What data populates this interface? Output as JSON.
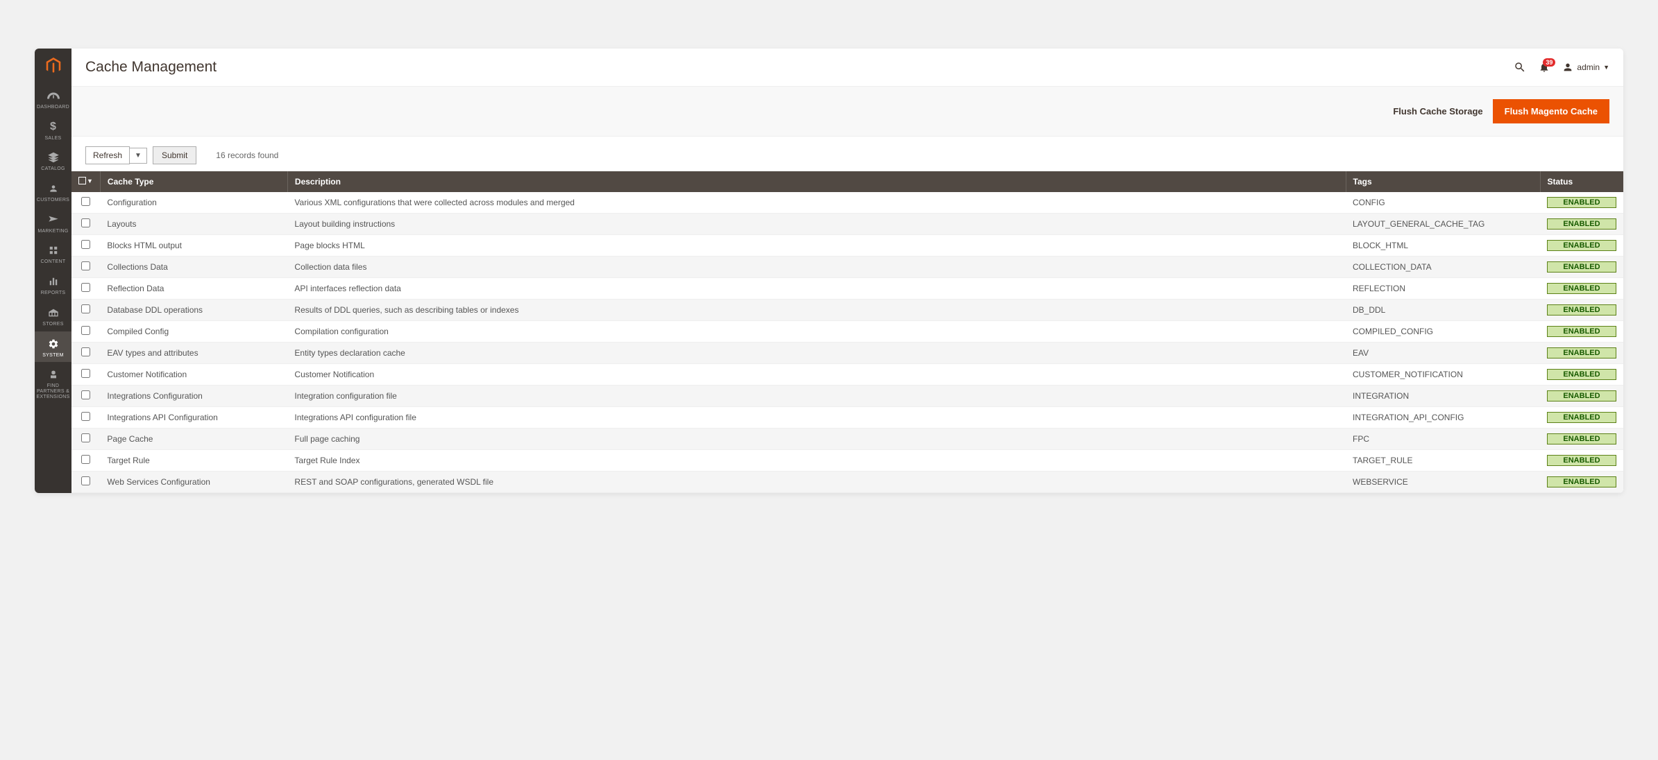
{
  "page": {
    "title": "Cache Management"
  },
  "header": {
    "notification_count": "39",
    "user_label": "admin"
  },
  "actions": {
    "flush_storage": "Flush Cache Storage",
    "flush_magento": "Flush Magento Cache"
  },
  "toolbar": {
    "refresh": "Refresh",
    "submit": "Submit",
    "records": "16 records found"
  },
  "columns": {
    "cache_type": "Cache Type",
    "description": "Description",
    "tags": "Tags",
    "status": "Status"
  },
  "status_label": "ENABLED",
  "sidebar": [
    {
      "label": "DASHBOARD"
    },
    {
      "label": "SALES"
    },
    {
      "label": "CATALOG"
    },
    {
      "label": "CUSTOMERS"
    },
    {
      "label": "MARKETING"
    },
    {
      "label": "CONTENT"
    },
    {
      "label": "REPORTS"
    },
    {
      "label": "STORES"
    },
    {
      "label": "SYSTEM"
    },
    {
      "label": "FIND PARTNERS & EXTENSIONS"
    }
  ],
  "rows": [
    {
      "type": "Configuration",
      "desc": "Various XML configurations that were collected across modules and merged",
      "tags": "CONFIG"
    },
    {
      "type": "Layouts",
      "desc": "Layout building instructions",
      "tags": "LAYOUT_GENERAL_CACHE_TAG"
    },
    {
      "type": "Blocks HTML output",
      "desc": "Page blocks HTML",
      "tags": "BLOCK_HTML"
    },
    {
      "type": "Collections Data",
      "desc": "Collection data files",
      "tags": "COLLECTION_DATA"
    },
    {
      "type": "Reflection Data",
      "desc": "API interfaces reflection data",
      "tags": "REFLECTION"
    },
    {
      "type": "Database DDL operations",
      "desc": "Results of DDL queries, such as describing tables or indexes",
      "tags": "DB_DDL"
    },
    {
      "type": "Compiled Config",
      "desc": "Compilation configuration",
      "tags": "COMPILED_CONFIG"
    },
    {
      "type": "EAV types and attributes",
      "desc": "Entity types declaration cache",
      "tags": "EAV"
    },
    {
      "type": "Customer Notification",
      "desc": "Customer Notification",
      "tags": "CUSTOMER_NOTIFICATION"
    },
    {
      "type": "Integrations Configuration",
      "desc": "Integration configuration file",
      "tags": "INTEGRATION"
    },
    {
      "type": "Integrations API Configuration",
      "desc": "Integrations API configuration file",
      "tags": "INTEGRATION_API_CONFIG"
    },
    {
      "type": "Page Cache",
      "desc": "Full page caching",
      "tags": "FPC"
    },
    {
      "type": "Target Rule",
      "desc": "Target Rule Index",
      "tags": "TARGET_RULE"
    },
    {
      "type": "Web Services Configuration",
      "desc": "REST and SOAP configurations, generated WSDL file",
      "tags": "WEBSERVICE"
    }
  ]
}
